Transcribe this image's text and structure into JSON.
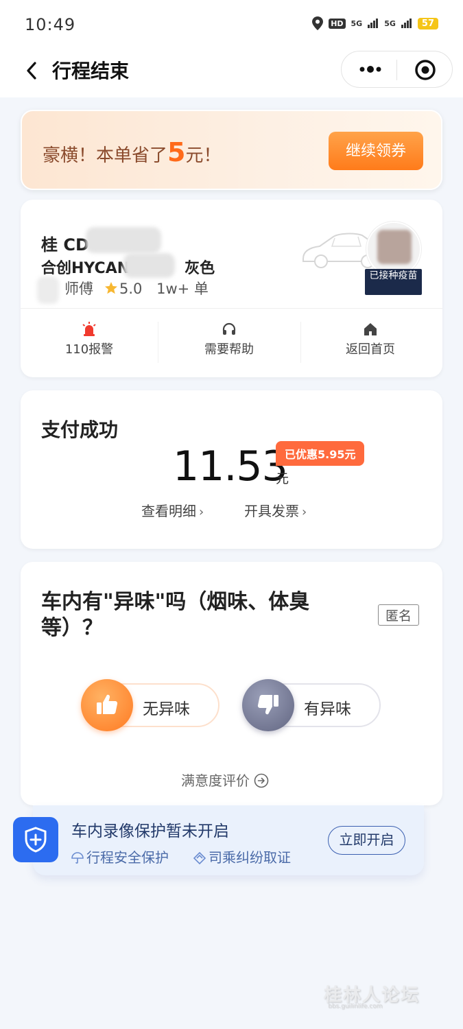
{
  "status_bar": {
    "time": "10:49",
    "hd_label": "HD",
    "signal1_label": "5G",
    "signal2_label": "5G",
    "battery": "57"
  },
  "nav": {
    "title": "行程结束",
    "icons": [
      "chevron-left-icon",
      "more-dots-icon",
      "target-icon"
    ]
  },
  "promo": {
    "text_prefix": "豪横！本单省了",
    "amount": "5",
    "text_suffix": "元！",
    "button_label": "继续领券",
    "accent_color": "#ff7b1a"
  },
  "driver": {
    "plate": "桂 CD",
    "car_model": "合创HYCAN",
    "car_color": "灰色",
    "driver_name": "师傅",
    "rating": "5.0",
    "orders": "1w+ 单",
    "vaccine_badge": "已接种疫苗",
    "actions": [
      {
        "label": "110报警",
        "icon": "alarm-light-icon"
      },
      {
        "label": "需要帮助",
        "icon": "headset-icon"
      },
      {
        "label": "返回首页",
        "icon": "home-icon"
      }
    ]
  },
  "payment": {
    "title": "支付成功",
    "amount": "11.53",
    "unit": "元",
    "discount_badge": "已优惠5.95元",
    "details_link": "查看明细",
    "invoice_link": "开具发票"
  },
  "survey": {
    "question": "车内有\"异味\"吗（烟味、体臭等）？",
    "anonymous_tag": "匿名",
    "option_good": "无异味",
    "option_bad": "有异味",
    "rating_link": "满意度评价"
  },
  "video_banner": {
    "title": "车内录像保护暂未开启",
    "tag1": "行程安全保护",
    "tag2": "司乘纠纷取证",
    "button_label": "立即开启",
    "icon": "shield-plus-icon"
  },
  "watermark": {
    "text": "桂林人论坛",
    "sub": "bbs.guilinlife.com"
  },
  "colors": {
    "orange": "#ff7b1a",
    "discount_red": "#ff6a3d",
    "shield_blue": "#2c6cf0",
    "page_bg": "#f3f6fb"
  }
}
